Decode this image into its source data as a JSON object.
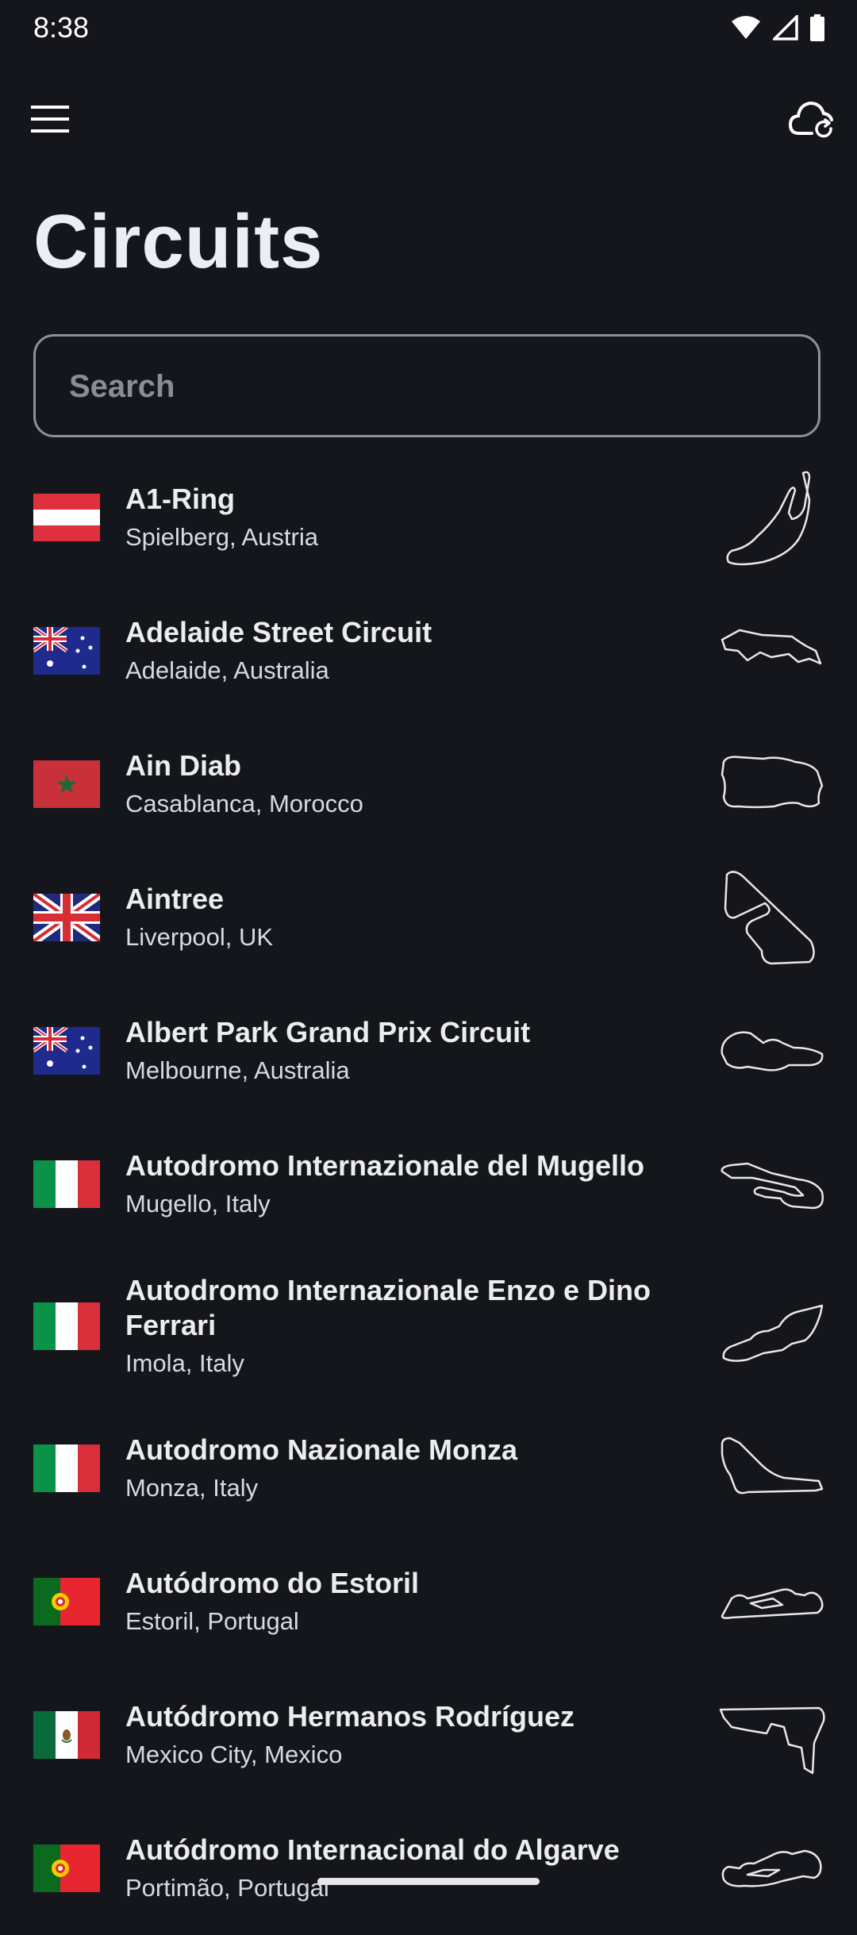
{
  "status_bar": {
    "time": "8:38"
  },
  "app_bar": {
    "menu_icon": "hamburger-menu-icon",
    "sync_icon": "cloud-sync-icon"
  },
  "page": {
    "title": "Circuits"
  },
  "search": {
    "placeholder": "Search",
    "value": ""
  },
  "circuits": [
    {
      "name": "A1-Ring",
      "location": "Spielberg, Austria",
      "flag": "austria"
    },
    {
      "name": "Adelaide Street Circuit",
      "location": "Adelaide, Australia",
      "flag": "australia"
    },
    {
      "name": "Ain Diab",
      "location": "Casablanca, Morocco",
      "flag": "morocco"
    },
    {
      "name": "Aintree",
      "location": "Liverpool, UK",
      "flag": "uk"
    },
    {
      "name": "Albert Park Grand Prix Circuit",
      "location": "Melbourne, Australia",
      "flag": "australia"
    },
    {
      "name": "Autodromo Internazionale del Mugello",
      "location": "Mugello, Italy",
      "flag": "italy"
    },
    {
      "name": "Autodromo Internazionale Enzo e Dino Ferrari",
      "location": "Imola, Italy",
      "flag": "italy"
    },
    {
      "name": "Autodromo Nazionale Monza",
      "location": "Monza, Italy",
      "flag": "italy"
    },
    {
      "name": "Autódromo do Estoril",
      "location": "Estoril, Portugal",
      "flag": "portugal"
    },
    {
      "name": "Autódromo Hermanos Rodríguez",
      "location": "Mexico City, Mexico",
      "flag": "mexico"
    },
    {
      "name": "Autódromo Internacional do Algarve",
      "location": "Portimão, Portugal",
      "flag": "portugal"
    }
  ],
  "colors": {
    "background": "#14161c",
    "text": "#ffffff",
    "border": "#8e9098"
  }
}
